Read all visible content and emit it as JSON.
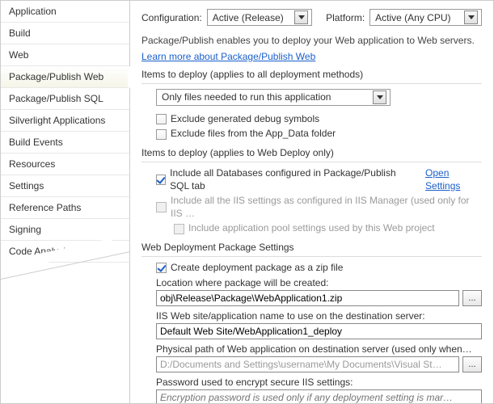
{
  "sidebar": {
    "items": [
      {
        "label": "Application"
      },
      {
        "label": "Build"
      },
      {
        "label": "Web"
      },
      {
        "label": "Package/Publish Web"
      },
      {
        "label": "Package/Publish SQL"
      },
      {
        "label": "Silverlight Applications"
      },
      {
        "label": "Build Events"
      },
      {
        "label": "Resources"
      },
      {
        "label": "Settings"
      },
      {
        "label": "Reference Paths"
      },
      {
        "label": "Signing"
      },
      {
        "label": "Code Analysis"
      }
    ],
    "selected_index": 3
  },
  "top": {
    "configuration_label": "Configuration:",
    "configuration_value": "Active (Release)",
    "platform_label": "Platform:",
    "platform_value": "Active (Any CPU)"
  },
  "description": "Package/Publish enables you to deploy your Web application to Web servers.",
  "learn_more": "Learn more about Package/Publish Web",
  "section1": {
    "title": "Items to deploy (applies to all deployment methods)",
    "dropdown_value": "Only files needed to run this application",
    "exclude_debug": "Exclude generated debug symbols",
    "exclude_appdata": "Exclude files from the App_Data folder"
  },
  "section2": {
    "title": "Items to deploy (applies to Web Deploy only)",
    "include_db": "Include all Databases configured in Package/Publish SQL tab",
    "open_settings": "Open Settings",
    "include_iis": "Include all the IIS settings as configured in IIS Manager (used only for IIS …",
    "include_apppool": "Include application pool settings used by this Web project"
  },
  "section3": {
    "title": "Web Deployment Package Settings",
    "create_zip": "Create deployment package as a zip file",
    "location_label": "Location where package will be created:",
    "location_value": "obj\\Release\\Package\\WebApplication1.zip",
    "iis_label": "IIS Web site/application name to use on the destination server:",
    "iis_value": "Default Web Site/WebApplication1_deploy",
    "physical_label": "Physical path of Web application on destination server (used only when…",
    "physical_value": "D:/Documents and Settings\\username\\My Documents\\Visual St…",
    "password_label": "Password used to encrypt secure IIS settings:",
    "password_hint": "Encryption password is used only if any deployment setting is mar…",
    "browse": "..."
  }
}
